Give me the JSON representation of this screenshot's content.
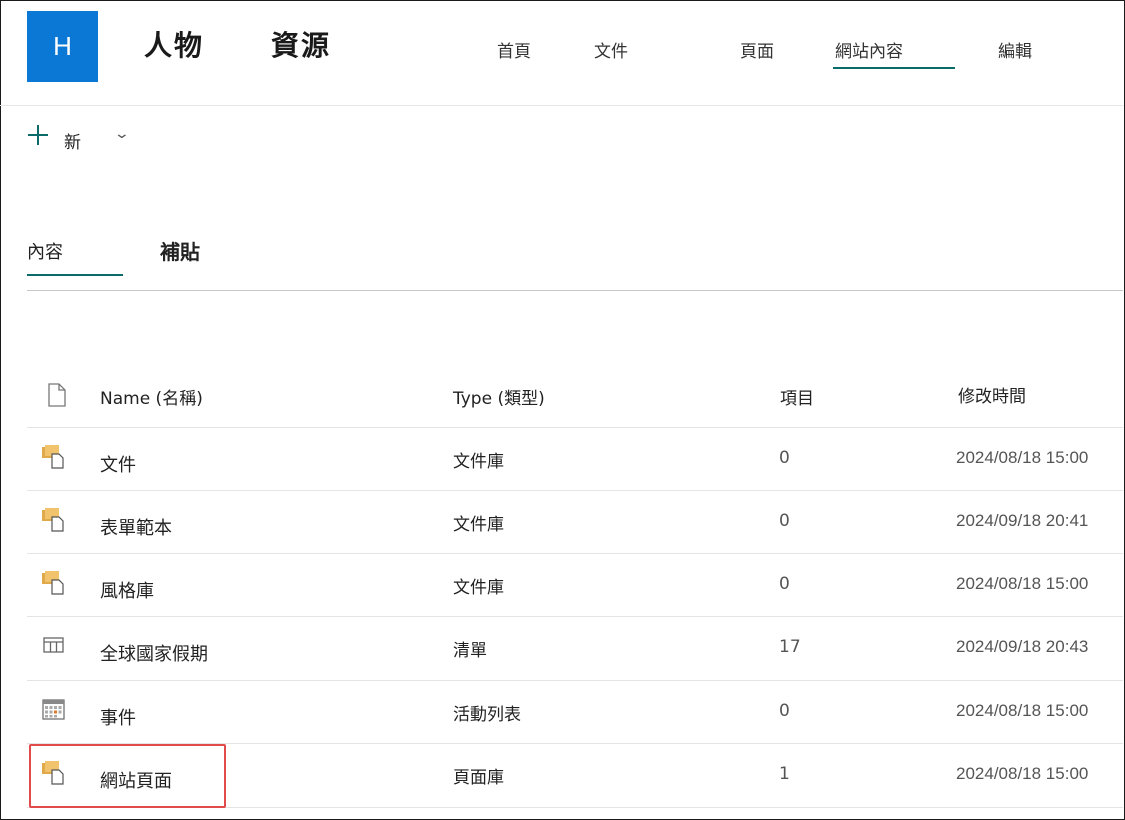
{
  "site": {
    "logo_letter": "H",
    "title_part1": "人物",
    "title_part2": "資源"
  },
  "nav": [
    {
      "label": "首頁"
    },
    {
      "label": "文件"
    },
    {
      "label": "頁面"
    },
    {
      "label": "網站內容",
      "active": true
    },
    {
      "label": "編輯"
    }
  ],
  "command_bar": {
    "new_label": "新",
    "chevron": "⌄"
  },
  "tabs": [
    {
      "label": "內容",
      "active": true
    },
    {
      "label": "補貼"
    }
  ],
  "table": {
    "headers": {
      "icon": "document-icon",
      "name": "Name (名稱)",
      "type": "Type (類型)",
      "items": "項目",
      "modified": "修改時間"
    },
    "rows": [
      {
        "icon": "library-icon",
        "name": "文件",
        "type": "文件庫",
        "items": "0",
        "modified": "2024/08/18 15:00"
      },
      {
        "icon": "library-icon",
        "name": "表單範本",
        "type": "文件庫",
        "items": "0",
        "modified": "2024/09/18 20:41"
      },
      {
        "icon": "library-icon",
        "name": "風格庫",
        "type": "文件庫",
        "items": "0",
        "modified": "2024/08/18 15:00"
      },
      {
        "icon": "list-icon",
        "name": "全球國家假期",
        "type": "清單",
        "items": "17",
        "modified": "2024/09/18 20:43"
      },
      {
        "icon": "calendar-icon",
        "name": "事件",
        "type": "活動列表",
        "items": "0",
        "modified": "2024/08/18 15:00"
      },
      {
        "icon": "library-icon",
        "name": "網站頁面",
        "type": "頁面庫",
        "items": "1",
        "modified": "2024/08/18 15:00",
        "highlighted": true
      }
    ]
  },
  "colors": {
    "logo_bg": "#0a78d4",
    "accent": "#0b6a6a",
    "highlight_border": "#e24b4b",
    "library_icon": "#e0a94a"
  }
}
